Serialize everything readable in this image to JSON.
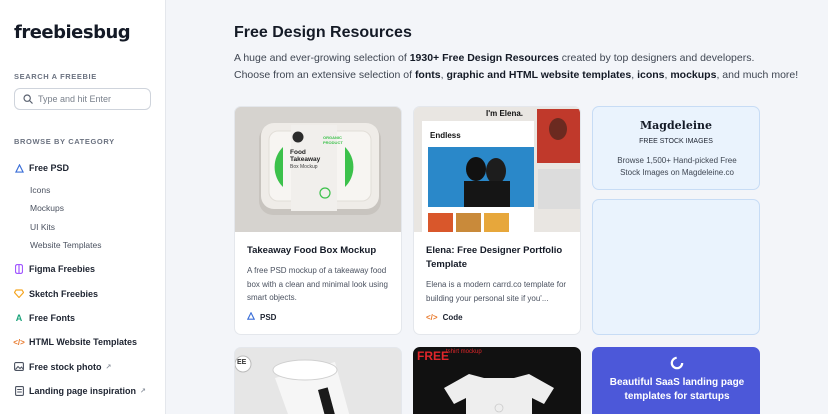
{
  "sidebar": {
    "logo": "freebiesbug",
    "search_label": "SEARCH A FREEBIE",
    "search_placeholder": "Type and hit Enter",
    "browse_label": "BROWSE BY CATEGORY",
    "free_psd": "Free PSD",
    "sub_items": [
      "Icons",
      "Mockups",
      "UI Kits",
      "Website Templates"
    ],
    "figma": "Figma Freebies",
    "sketch": "Sketch Freebies",
    "fonts": "Free Fonts",
    "html": "HTML Website Templates",
    "stock": "Free stock photo",
    "landing": "Landing page inspiration"
  },
  "main": {
    "title": "Free Design Resources",
    "desc_1a": "A huge and ever-growing selection of ",
    "desc_1b": "1930+ Free Design Resources",
    "desc_1c": " created by top designers and developers.",
    "desc_2a": "Choose from an extensive selection of ",
    "desc_2b": "fonts",
    "desc_2c": ", ",
    "desc_2d": "graphic and HTML website templates",
    "desc_2e": ", ",
    "desc_2f": "icons",
    "desc_2g": ", ",
    "desc_2h": "mockups",
    "desc_2i": ", and much more!"
  },
  "cards": [
    {
      "title": "Takeaway Food Box Mockup",
      "desc": "A free PSD mockup of a takeaway food box with a clean and minimal look using smart objects.",
      "tag": "PSD",
      "thumb_text": [
        "Food",
        "Takeaway",
        "Box Mockup",
        "ORGANIC",
        "PRODUCT"
      ]
    },
    {
      "title": "Elena: Free Designer Portfolio Template",
      "desc": "Elena is a modern carrd.co template for building your personal site if you'...",
      "tag": "Code",
      "thumb_text": [
        "I'm Elena.",
        "Endless"
      ]
    }
  ],
  "ad": {
    "brand": "Magdeleine",
    "sub": "FREE STOCK IMAGES",
    "desc": "Browse 1,500+ Hand-picked Free Stock Images on Magdeleine.co"
  },
  "bottom": {
    "shirt_label": "FREE",
    "shirt_sub": "tshirt mockup",
    "cup_label": "EE",
    "saas_text": "Beautiful SaaS landing page templates for startups"
  }
}
